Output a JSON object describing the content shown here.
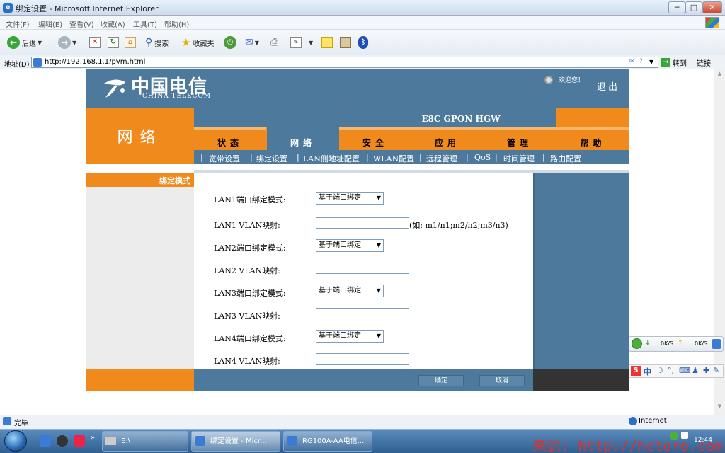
{
  "window": {
    "title": "绑定设置 - Microsoft Internet Explorer",
    "min_glyph": "─",
    "max_glyph": "□",
    "close_glyph": "✕"
  },
  "menu": [
    "文件(F)",
    "编辑(E)",
    "查看(V)",
    "收藏(A)",
    "工具(T)",
    "帮助(H)"
  ],
  "toolbar": {
    "back_label": "后退",
    "search_label": "搜索",
    "favorites_label": "收藏夹"
  },
  "address": {
    "label": "地址(D)",
    "url": "http://192.168.1.1/pvm.html",
    "go_label": "转到",
    "links_label": "链接"
  },
  "router": {
    "logo_cn": "中国电信",
    "logo_en": "CHINA TELECOM",
    "welcome": "欢迎您！",
    "logout": "退出",
    "section_title": "网络",
    "model": "E8C GPON HGW",
    "tabs": [
      "状态",
      "网络",
      "安全",
      "应用",
      "管理",
      "帮助"
    ],
    "active_tab": 1,
    "subnav": [
      "宽带设置",
      "绑定设置",
      "LAN侧地址配置",
      "WLAN配置",
      "远程管理",
      "QoS",
      "时间管理",
      "路由配置"
    ],
    "left_label": "绑定模式",
    "form": {
      "lan1_mode_label": "LAN1端口绑定模式:",
      "lan1_mode_value": "基于端口绑定",
      "lan1_vlan_label": "LAN1 VLAN映射:",
      "lan1_hint": "(如: m1/n1;m2/n2;m3/n3)",
      "lan2_mode_label": "LAN2端口绑定模式:",
      "lan2_mode_value": "基于端口绑定",
      "lan2_vlan_label": "LAN2 VLAN映射:",
      "lan3_mode_label": "LAN3端口绑定模式:",
      "lan3_mode_value": "基于端口绑定",
      "lan3_vlan_label": "LAN3 VLAN映射:",
      "lan4_mode_label": "LAN4端口绑定模式:",
      "lan4_mode_value": "基于端口绑定",
      "lan4_vlan_label": "LAN4 VLAN映射:"
    },
    "ok_label": "确定",
    "cancel_label": "取消"
  },
  "net_widget": {
    "down": "0K/S",
    "up": "0K/S"
  },
  "ime": {
    "mode": "中"
  },
  "status": {
    "text": "完毕",
    "zone": "Internet"
  },
  "taskbar": {
    "tasks": [
      "E:\\",
      "绑定设置 - Micr...",
      "RG100A-AA电信..."
    ],
    "active_task": 1,
    "watermark": "来源: http://hctoro.com",
    "clock": "12:44"
  },
  "colors": {
    "telecom_blue": "#4d7a9c",
    "telecom_orange": "#f08a1c"
  }
}
